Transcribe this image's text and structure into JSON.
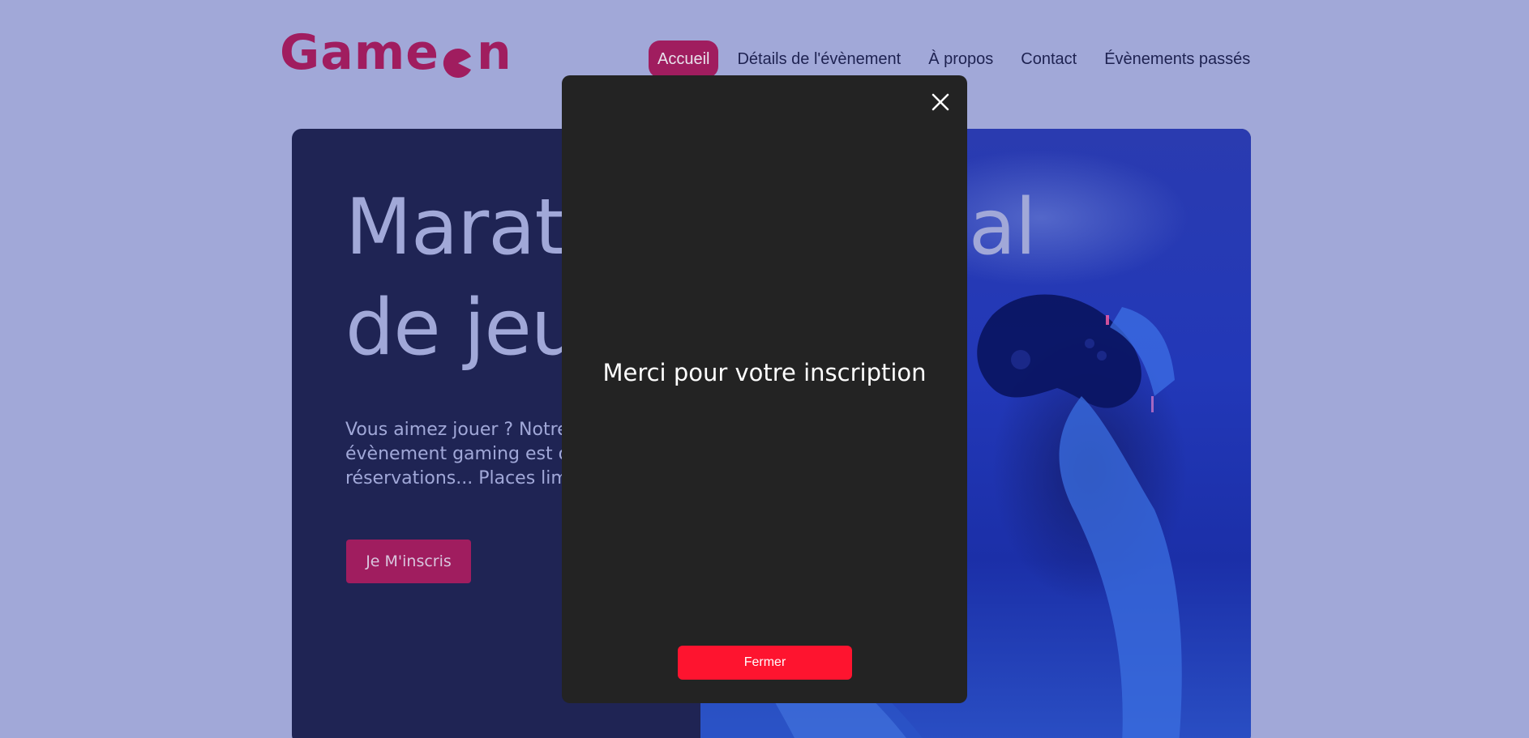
{
  "brand": {
    "logo_part1": "Game",
    "logo_part2": "n",
    "color": "#a01d5f"
  },
  "nav": {
    "items": [
      {
        "label": "Accueil",
        "active": true
      },
      {
        "label": "Détails de l'évènement",
        "active": false
      },
      {
        "label": "À propos",
        "active": false
      },
      {
        "label": "Contact",
        "active": false
      },
      {
        "label": "Évènements passés",
        "active": false
      }
    ]
  },
  "hero": {
    "title_line1": "Marathon national",
    "title_line2": "de jeux vidéos",
    "text": "Vous aimez jouer ? Notre prochain évènement gaming est ouvert aux réservations... Places limitées !",
    "cta_label": "Je M'inscris",
    "image_icon": "gamer-with-controller-image"
  },
  "modal": {
    "message": "Merci pour votre inscription",
    "close_icon": "close-icon",
    "button_label": "Fermer",
    "button_color": "#fe142f",
    "background": "#232323"
  },
  "colors": {
    "page_bg": "#a1a8d8",
    "hero_bg": "#1f2454",
    "accent": "#a01d5f"
  }
}
